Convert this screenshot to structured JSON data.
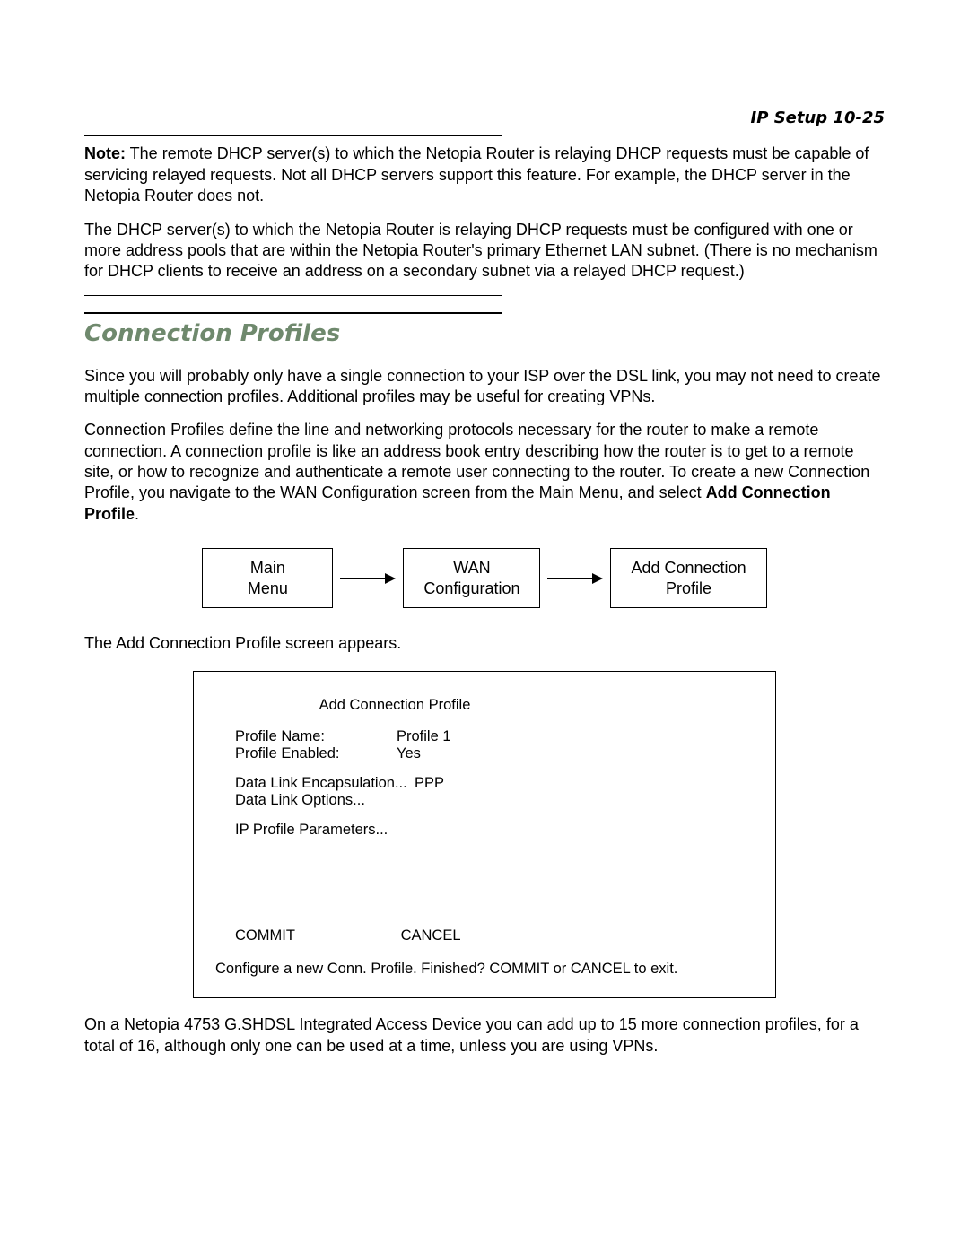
{
  "runhead": "IP Setup   10-25",
  "note": {
    "label": "Note:",
    "text": " The remote DHCP server(s) to which the Netopia Router is relaying DHCP requests must be capable of servicing relayed requests. Not all DHCP servers support this feature. For example, the DHCP server in the Netopia Router does not."
  },
  "para_dhcp": "The DHCP server(s) to which the Netopia Router is relaying DHCP requests must be configured with one or more address pools that are within the Netopia Router's primary Ethernet LAN subnet. (There is no mechanism for DHCP clients to receive an address on a secondary subnet via a relayed DHCP request.)",
  "section_title": "Connection Profiles",
  "para_cp1": "Since you will probably only have a single connection to your ISP over the DSL link, you may not need to create multiple connection profiles. Additional profiles may be useful for creating VPNs.",
  "para_cp2_a": "Connection Profiles define the line and networking protocols necessary for the router to make a remote connection. A connection profile is like an address book entry describing how the router is to get to a remote site, or how to recognize and authenticate a remote user connecting to the router. To create a new Connection Profile, you navigate to the WAN Configuration screen from the Main Menu, and select ",
  "para_cp2_bold": "Add Connection Profile",
  "para_cp2_b": ".",
  "nav": {
    "box1_l1": "Main",
    "box1_l2": "Menu",
    "box2_l1": "WAN",
    "box2_l2": "Configuration",
    "box3_l1": "Add Connection",
    "box3_l2": "Profile"
  },
  "para_appears": "The Add Connection Profile screen appears.",
  "term": {
    "title": "Add Connection Profile",
    "rows": {
      "name_label": "Profile Name:",
      "name_value": "Profile 1",
      "enabled_label": "Profile Enabled:",
      "enabled_value": "Yes",
      "encap_label": "Data Link Encapsulation...",
      "encap_value": "PPP",
      "opts_label": "Data Link Options...",
      "ipparams": "IP Profile Parameters..."
    },
    "commit": "COMMIT",
    "cancel": "CANCEL",
    "footer": "Configure a new Conn. Profile. Finished?  COMMIT or CANCEL to exit."
  },
  "para_after": "On a Netopia 4753 G.SHDSL Integrated Access Device you can add up to 15 more connection profiles, for a total of 16, although only one can be used at a time, unless you are using VPNs."
}
